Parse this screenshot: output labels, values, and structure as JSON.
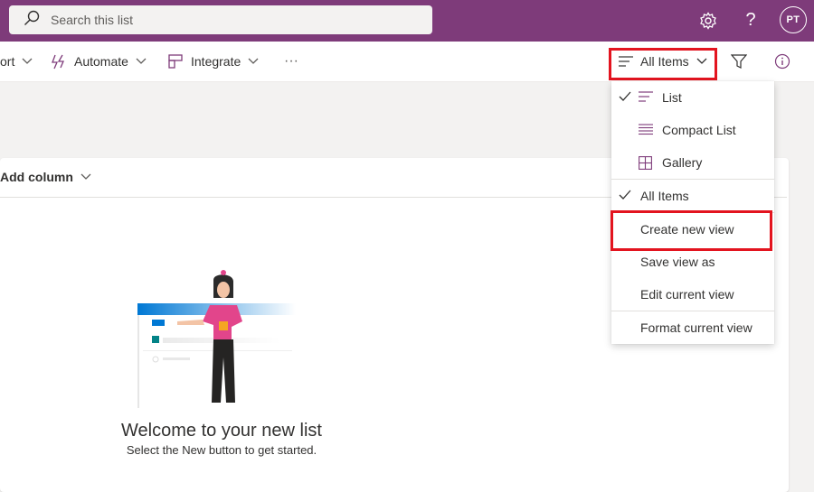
{
  "search": {
    "placeholder": "Search this list"
  },
  "header": {
    "avatar_initials": "PT"
  },
  "command_bar": {
    "export_partial": "ort",
    "automate": "Automate",
    "integrate": "Integrate",
    "more": "···",
    "view_selector": "All Items"
  },
  "list": {
    "add_column": "Add column"
  },
  "empty_state": {
    "title": "Welcome to your new list",
    "subtitle": "Select the New button to get started."
  },
  "view_menu": {
    "items": [
      {
        "label": "List",
        "checked": true,
        "icon": "list-icon"
      },
      {
        "label": "Compact List",
        "checked": false,
        "icon": "compact-list-icon"
      },
      {
        "label": "Gallery",
        "checked": false,
        "icon": "gallery-icon"
      },
      {
        "label": "All Items",
        "checked": true
      },
      {
        "label": "Create new view",
        "highlighted": true
      },
      {
        "label": "Save view as"
      },
      {
        "label": "Edit current view"
      },
      {
        "label": "Format current view"
      }
    ]
  },
  "colors": {
    "suite_bar": "#7e3b7a",
    "accent": "#7e3b7a",
    "highlight_box": "#e3141f"
  }
}
